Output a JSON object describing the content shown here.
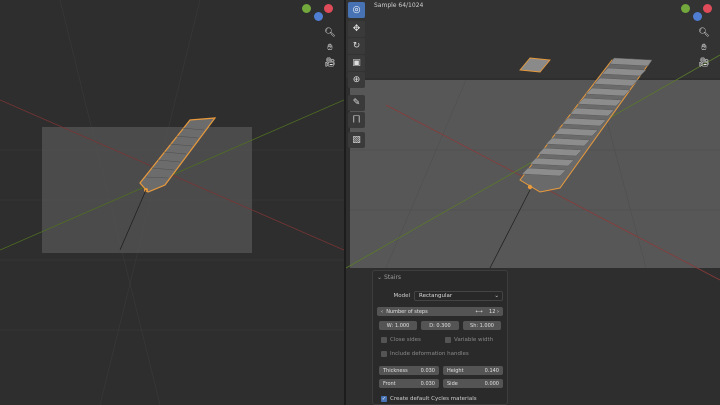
{
  "viewport_right": {
    "sample_text": "Sample 64/1024"
  },
  "gizmo": {
    "x_color": "#e04b5a",
    "y_color": "#72a83c",
    "z_color": "#4f7dd1"
  },
  "nav_icons": [
    "zoom-icon",
    "hand-icon",
    "camera-icon"
  ],
  "tools": [
    "select-cursor-icon",
    "move-icon",
    "rotate-icon",
    "scale-icon",
    "transform-icon",
    "annotate-icon",
    "measure-icon",
    "add-cube-icon"
  ],
  "panel": {
    "title": "Stairs",
    "model_label": "Model",
    "model_value": "Rectangular",
    "steps_label": "Number of steps",
    "steps_value": "12",
    "w_label": "W",
    "w_value": "1.000",
    "d_label": "D",
    "d_value": "0.300",
    "sh_label": "Sh",
    "sh_value": "1.000",
    "close_sides": "Close sides",
    "variable_width": "Variable width",
    "include_deformation": "Include deformation handles",
    "thickness_label": "Thickness",
    "thickness_value": "0.030",
    "height_label": "Height",
    "height_value": "0.140",
    "front_label": "Front",
    "front_value": "0.030",
    "side_label": "Side",
    "side_value": "0.000",
    "cycles_label": "Create default Cycles materials"
  },
  "colors": {
    "selection_orange": "#e89a3c",
    "x_axis_red": "#8a3a3a",
    "y_axis_green": "#5a7a2a"
  }
}
